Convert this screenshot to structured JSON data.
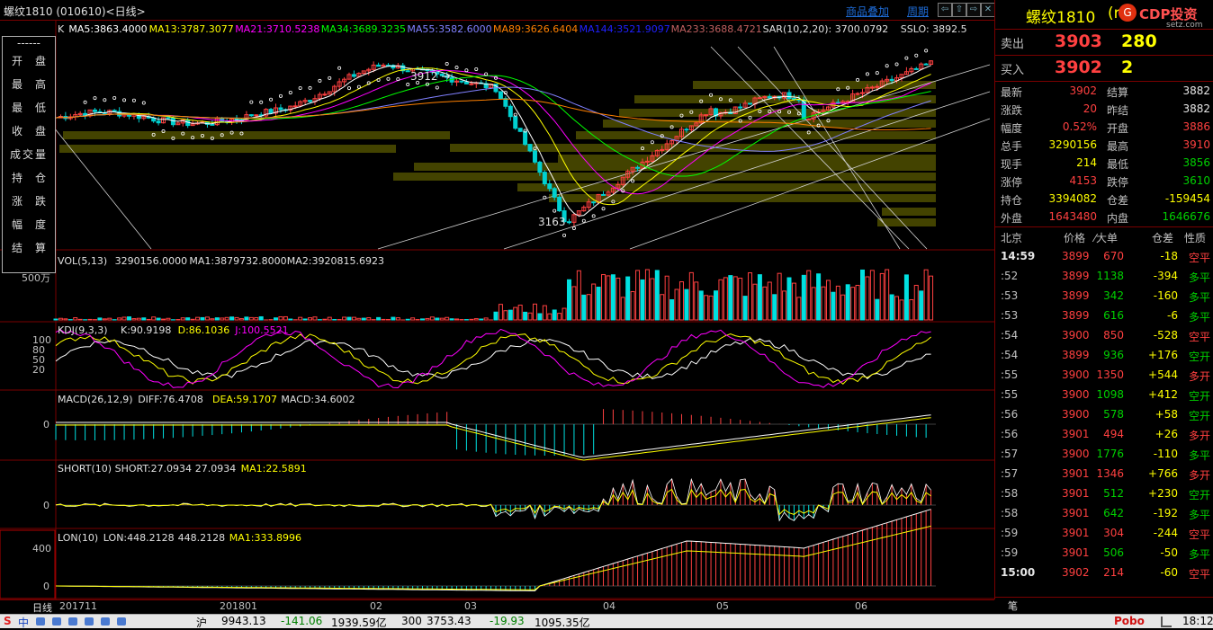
{
  "window": {
    "symbol_title": "螺纹1810 (010610)<日线>",
    "overlay_link": "商品叠加",
    "period_link": "周期",
    "nav_buttons": [
      "⇦",
      "⇧",
      "⇨",
      "✕"
    ]
  },
  "left_menu": {
    "dash": "------",
    "items": [
      "开盘",
      "最高",
      "最低",
      "收盘",
      "成交量",
      "持仓",
      "涨跌",
      "幅度",
      "结算"
    ]
  },
  "main_panel": {
    "k_label": "K",
    "legend": [
      {
        "text": "MA5:3863.4000",
        "color": "#ffffff"
      },
      {
        "text": "MA13:3787.3077",
        "color": "#ffff00"
      },
      {
        "text": "MA21:3710.5238",
        "color": "#ff00ff"
      },
      {
        "text": "MA34:3689.3235",
        "color": "#00ff00"
      },
      {
        "text": "MA55:3582.6000",
        "color": "#8080ff"
      },
      {
        "text": "MA89:3626.6404",
        "color": "#ff8000"
      },
      {
        "text": "MA144:3521.9097",
        "color": "#2020ff"
      },
      {
        "text": "MA233:3688.4721",
        "color": "#c06060"
      },
      {
        "text": "SAR(10,2,20): 3700.0792",
        "color": "#e0e0e0"
      },
      {
        "text": "SSLO: 3892.5",
        "color": "#e0e0e0"
      }
    ],
    "high_label": "3912",
    "low_label": "3163",
    "arrow": "→"
  },
  "vol_panel": {
    "label": "VOL(5,13)",
    "legend": [
      {
        "text": "3290156.0000",
        "color": "#e0e0e0"
      },
      {
        "text": "MA1:3879732.8000",
        "color": "#e0e0e0"
      },
      {
        "text": "MA2:3920815.6923",
        "color": "#e0e0e0"
      }
    ],
    "axis": "500万"
  },
  "kdj_panel": {
    "label": "KDJ(9,3,3)",
    "legend": [
      {
        "text": "K:90.9198",
        "color": "#e0e0e0"
      },
      {
        "text": "D:86.1036",
        "color": "#ffff00"
      },
      {
        "text": "J:100.5521",
        "color": "#ff00ff"
      }
    ],
    "axis": [
      "100",
      "80",
      "50",
      "20"
    ]
  },
  "macd_panel": {
    "label": "MACD(26,12,9)",
    "legend": [
      {
        "text": "DIFF:76.4708",
        "color": "#e0e0e0"
      },
      {
        "text": "DEA:59.1707",
        "color": "#ffff00"
      },
      {
        "text": "MACD:34.6002",
        "color": "#e0e0e0"
      }
    ],
    "axis": "0"
  },
  "short_panel": {
    "label": "SHORT(10)",
    "legend": [
      {
        "text": "SHORT:27.0934",
        "color": "#e0e0e0"
      },
      {
        "text": "27.0934",
        "color": "#e0e0e0"
      },
      {
        "text": "MA1:22.5891",
        "color": "#ffff00"
      }
    ],
    "axis": "0"
  },
  "lon_panel": {
    "label": "LON(10)",
    "legend": [
      {
        "text": "LON:448.2128",
        "color": "#e0e0e0"
      },
      {
        "text": "448.2128",
        "color": "#e0e0e0"
      },
      {
        "text": "MA1:333.8996",
        "color": "#ffff00"
      }
    ],
    "axis": [
      "400",
      "0"
    ]
  },
  "date_axis": {
    "period": "日线",
    "labels": [
      "201711",
      "201801",
      "02",
      "03",
      "04",
      "05",
      "06"
    ]
  },
  "right_panel": {
    "name": "螺纹1810",
    "name_suffix": "(r",
    "brand": "CDP投资",
    "brand_sub": "setz.com",
    "sell": {
      "label": "卖出",
      "price": "3903",
      "vol": "280"
    },
    "buy": {
      "label": "买入",
      "price": "3902",
      "vol": "2"
    },
    "stats": [
      {
        "l1": "最新",
        "v1": "3902",
        "c1": "red",
        "l2": "结算",
        "v2": "3882",
        "c2": "wht"
      },
      {
        "l1": "涨跌",
        "v1": "20",
        "c1": "red",
        "l2": "昨结",
        "v2": "3882",
        "c2": "wht"
      },
      {
        "l1": "幅度",
        "v1": "0.52%",
        "c1": "red",
        "l2": "开盘",
        "v2": "3886",
        "c2": "red"
      },
      {
        "l1": "总手",
        "v1": "3290156",
        "c1": "yel",
        "l2": "最高",
        "v2": "3910",
        "c2": "red"
      },
      {
        "l1": "现手",
        "v1": "214",
        "c1": "yel",
        "l2": "最低",
        "v2": "3856",
        "c2": "grn"
      },
      {
        "l1": "涨停",
        "v1": "4153",
        "c1": "red",
        "l2": "跌停",
        "v2": "3610",
        "c2": "grn"
      },
      {
        "l1": "持仓",
        "v1": "3394082",
        "c1": "yel",
        "l2": "仓差",
        "v2": "-159454",
        "c2": "yel"
      },
      {
        "l1": "外盘",
        "v1": "1643480",
        "c1": "red",
        "l2": "内盘",
        "v2": "1646676",
        "c2": "grn"
      }
    ],
    "ticks_header": {
      "loc": "北京",
      "price": "价格",
      "bigorder": "⁄大单",
      "oi": "仓差",
      "nature": "性质"
    },
    "ticks": [
      {
        "t": "14:59",
        "p": "3899",
        "v": "670",
        "oi": "-18",
        "n": "空平",
        "vc": "red",
        "oic": "yel",
        "nc": "red"
      },
      {
        "t": ":52",
        "p": "3899",
        "v": "1138",
        "oi": "-394",
        "n": "多平",
        "vc": "grn",
        "oic": "yel",
        "nc": "grn"
      },
      {
        "t": ":53",
        "p": "3899",
        "v": "342",
        "oi": "-160",
        "n": "多平",
        "vc": "grn",
        "oic": "yel",
        "nc": "grn"
      },
      {
        "t": ":53",
        "p": "3899",
        "v": "616",
        "oi": "-6",
        "n": "多平",
        "vc": "grn",
        "oic": "yel",
        "nc": "grn"
      },
      {
        "t": ":54",
        "p": "3900",
        "v": "850",
        "oi": "-528",
        "n": "空平",
        "vc": "red",
        "oic": "yel",
        "nc": "red"
      },
      {
        "t": ":54",
        "p": "3899",
        "v": "936",
        "oi": "+176",
        "n": "空开",
        "vc": "grn",
        "oic": "yel",
        "nc": "grn"
      },
      {
        "t": ":55",
        "p": "3900",
        "v": "1350",
        "oi": "+544",
        "n": "多开",
        "vc": "red",
        "oic": "yel",
        "nc": "red"
      },
      {
        "t": ":55",
        "p": "3900",
        "v": "1098",
        "oi": "+412",
        "n": "空开",
        "vc": "grn",
        "oic": "yel",
        "nc": "grn"
      },
      {
        "t": ":56",
        "p": "3900",
        "v": "578",
        "oi": "+58",
        "n": "空开",
        "vc": "grn",
        "oic": "yel",
        "nc": "grn"
      },
      {
        "t": ":56",
        "p": "3901",
        "v": "494",
        "oi": "+26",
        "n": "多开",
        "vc": "red",
        "oic": "yel",
        "nc": "red"
      },
      {
        "t": ":57",
        "p": "3900",
        "v": "1776",
        "oi": "-110",
        "n": "多平",
        "vc": "grn",
        "oic": "yel",
        "nc": "grn"
      },
      {
        "t": ":57",
        "p": "3901",
        "v": "1346",
        "oi": "+766",
        "n": "多开",
        "vc": "red",
        "oic": "yel",
        "nc": "red"
      },
      {
        "t": ":58",
        "p": "3901",
        "v": "512",
        "oi": "+230",
        "n": "空开",
        "vc": "grn",
        "oic": "yel",
        "nc": "grn"
      },
      {
        "t": ":58",
        "p": "3901",
        "v": "642",
        "oi": "-192",
        "n": "多平",
        "vc": "grn",
        "oic": "yel",
        "nc": "grn"
      },
      {
        "t": ":59",
        "p": "3901",
        "v": "304",
        "oi": "-244",
        "n": "空平",
        "vc": "red",
        "oic": "yel",
        "nc": "red"
      },
      {
        "t": ":59",
        "p": "3901",
        "v": "506",
        "oi": "-50",
        "n": "多平",
        "vc": "grn",
        "oic": "yel",
        "nc": "grn"
      },
      {
        "t": "15:00",
        "p": "3902",
        "v": "214",
        "oi": "-60",
        "n": "空平",
        "vc": "red",
        "oic": "yel",
        "nc": "red"
      }
    ],
    "footer_tab": "笔"
  },
  "status_bar": {
    "ime": "S",
    "ime_lang": "中",
    "index_name": "沪",
    "index_val": "9943.13",
    "index_chg": "-141.06",
    "index_amt": "1939.59亿",
    "idx2_name": "300",
    "idx2_val": "3753.43",
    "idx2_chg": "-19.93",
    "idx2_amt": "1095.35亿",
    "app": "Pobo",
    "time": "18:12"
  },
  "colors": {
    "bg": "#000000",
    "frame": "#7a0000",
    "up": "#ff4040",
    "down": "#00d0d0"
  }
}
